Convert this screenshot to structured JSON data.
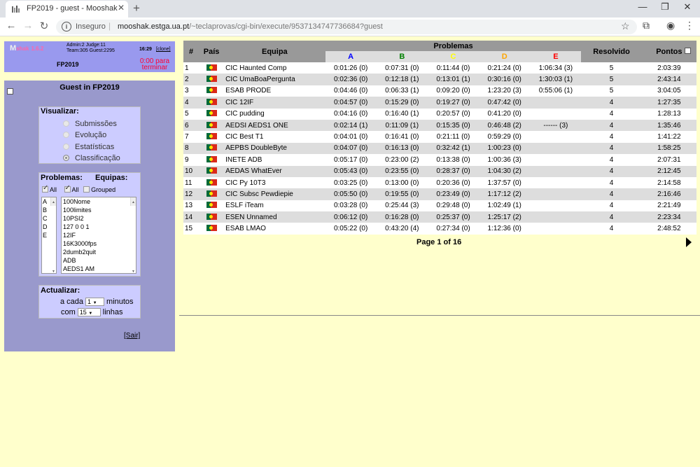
{
  "browser": {
    "tab_title": "FP2019 - guest - Mooshak",
    "security_label": "Inseguro",
    "url_host": "mooshak.estga.ua.pt",
    "url_path": "/~teclaprovas/cgi-bin/execute/9537134747736684?guest"
  },
  "header": {
    "logo": "M",
    "logo_suffix": "shak",
    "version": "1.6.2",
    "stats_line1": "Admin:2 Judge:11",
    "stats_line2": "Team:305 Guest:2295",
    "clock": "16:29",
    "clone": "[clone]",
    "contest": "FP2019",
    "countdown": "0:00 para terminar"
  },
  "panel": {
    "title": "Guest in FP2019",
    "visualizar": {
      "title": "Visualizar:",
      "options": [
        "Submissões",
        "Evolução",
        "Estatísticas",
        "Classificação"
      ],
      "selected": "Classificação"
    },
    "filters": {
      "problems_title": "Problemas:",
      "teams_title": "Equipas:",
      "all_label_1": "All",
      "all_label_2": "All",
      "grouped_label": "Grouped",
      "problems": [
        "A",
        "B",
        "C",
        "D",
        "E"
      ],
      "teams": [
        "100Nome",
        "100limites",
        "10PSI2",
        "127 0 0 1",
        "12IF",
        "16K3000fps",
        "2dumb2quit",
        "ADB",
        "AEDS1 AM"
      ]
    },
    "actualizar": {
      "title": "Actualizar:",
      "every_prefix": "a cada",
      "every_value": "1",
      "every_suffix": "minutos",
      "lines_prefix": "com",
      "lines_value": "15",
      "lines_suffix": "linhas"
    },
    "logout": "[Sair]"
  },
  "table": {
    "headers": {
      "rank": "#",
      "country": "País",
      "team": "Equipa",
      "problems": "Problemas",
      "solved": "Resolvido",
      "points": "Pontos"
    },
    "problem_columns": [
      {
        "label": "A",
        "color": "#0000ff"
      },
      {
        "label": "B",
        "color": "#008000"
      },
      {
        "label": "C",
        "color": "#ffff00"
      },
      {
        "label": "D",
        "color": "#ffa500"
      },
      {
        "label": "E",
        "color": "#ff0000"
      }
    ],
    "rows": [
      {
        "rank": "1",
        "team": "CIC Haunted Comp",
        "p": [
          "0:01:26 (0)",
          "0:07:31 (0)",
          "0:11:44 (0)",
          "0:21:24 (0)",
          "1:06:34 (3)"
        ],
        "solved": "5",
        "points": "2:03:39"
      },
      {
        "rank": "2",
        "team": "CIC UmaBoaPergunta",
        "p": [
          "0:02:36 (0)",
          "0:12:18 (1)",
          "0:13:01 (1)",
          "0:30:16 (0)",
          "1:30:03 (1)"
        ],
        "solved": "5",
        "points": "2:43:14"
      },
      {
        "rank": "3",
        "team": "ESAB PRODE",
        "p": [
          "0:04:46 (0)",
          "0:06:33 (1)",
          "0:09:20 (0)",
          "1:23:20 (3)",
          "0:55:06 (1)"
        ],
        "solved": "5",
        "points": "3:04:05"
      },
      {
        "rank": "4",
        "team": "CIC 12IF",
        "p": [
          "0:04:57 (0)",
          "0:15:29 (0)",
          "0:19:27 (0)",
          "0:47:42 (0)",
          ""
        ],
        "solved": "4",
        "points": "1:27:35"
      },
      {
        "rank": "5",
        "team": "CIC pudding",
        "p": [
          "0:04:16 (0)",
          "0:16:40 (1)",
          "0:20:57 (0)",
          "0:41:20 (0)",
          ""
        ],
        "solved": "4",
        "points": "1:28:13"
      },
      {
        "rank": "6",
        "team": "AEDSI AEDS1 ONE",
        "p": [
          "0:02:14 (1)",
          "0:11:09 (1)",
          "0:15:35 (0)",
          "0:46:48 (2)",
          "------ (3)"
        ],
        "solved": "4",
        "points": "1:35:46"
      },
      {
        "rank": "7",
        "team": "CIC Best T1",
        "p": [
          "0:04:01 (0)",
          "0:16:41 (0)",
          "0:21:11 (0)",
          "0:59:29 (0)",
          ""
        ],
        "solved": "4",
        "points": "1:41:22"
      },
      {
        "rank": "8",
        "team": "AEPBS DoubleByte",
        "p": [
          "0:04:07 (0)",
          "0:16:13 (0)",
          "0:32:42 (1)",
          "1:00:23 (0)",
          ""
        ],
        "solved": "4",
        "points": "1:58:25"
      },
      {
        "rank": "9",
        "team": "INETE ADB",
        "p": [
          "0:05:17 (0)",
          "0:23:00 (2)",
          "0:13:38 (0)",
          "1:00:36 (3)",
          ""
        ],
        "solved": "4",
        "points": "2:07:31"
      },
      {
        "rank": "10",
        "team": "AEDAS WhatEver",
        "p": [
          "0:05:43 (0)",
          "0:23:55 (0)",
          "0:28:37 (0)",
          "1:04:30 (2)",
          ""
        ],
        "solved": "4",
        "points": "2:12:45"
      },
      {
        "rank": "11",
        "team": "CIC Py 10T3",
        "p": [
          "0:03:25 (0)",
          "0:13:00 (0)",
          "0:20:36 (0)",
          "1:37:57 (0)",
          ""
        ],
        "solved": "4",
        "points": "2:14:58"
      },
      {
        "rank": "12",
        "team": "CIC Subsc Pewdiepie",
        "p": [
          "0:05:50 (0)",
          "0:19:55 (0)",
          "0:23:49 (0)",
          "1:17:12 (2)",
          ""
        ],
        "solved": "4",
        "points": "2:16:46"
      },
      {
        "rank": "13",
        "team": "ESLF iTeam",
        "p": [
          "0:03:28 (0)",
          "0:25:44 (3)",
          "0:29:48 (0)",
          "1:02:49 (1)",
          ""
        ],
        "solved": "4",
        "points": "2:21:49"
      },
      {
        "rank": "14",
        "team": "ESEN Unnamed",
        "p": [
          "0:06:12 (0)",
          "0:16:28 (0)",
          "0:25:37 (0)",
          "1:25:17 (2)",
          ""
        ],
        "solved": "4",
        "points": "2:23:34"
      },
      {
        "rank": "15",
        "team": "ESAB LMAO",
        "p": [
          "0:05:22 (0)",
          "0:43:20 (4)",
          "0:27:34 (0)",
          "1:12:36 (0)",
          ""
        ],
        "solved": "4",
        "points": "2:48:52"
      }
    ],
    "pager": "Page 1 of 16"
  }
}
